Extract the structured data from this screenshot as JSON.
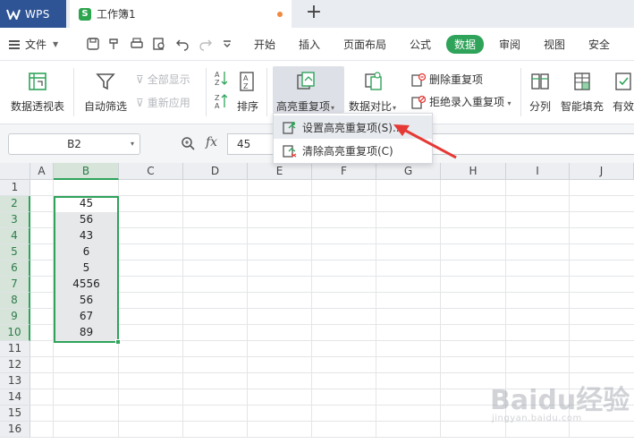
{
  "titlebar": {
    "app_tab": "WPS",
    "doc_tab": "工作簿1",
    "sheet_icon_letter": "S",
    "add_tab": "+"
  },
  "menubar": {
    "file": "文件",
    "tabs": [
      "开始",
      "插入",
      "页面布局",
      "公式",
      "数据",
      "审阅",
      "视图",
      "安全"
    ],
    "active_tab": "数据"
  },
  "ribbon": {
    "pivot": "数据透视表",
    "autofilter": "自动筛选",
    "show_all": "全部显示",
    "reapply": "重新应用",
    "sort": "排序",
    "highlight_dup": "高亮重复项",
    "compare": "数据对比",
    "remove_dup": "删除重复项",
    "reject_dup": "拒绝录入重复项",
    "split": "分列",
    "smart_fill": "智能填充",
    "valid": "有效"
  },
  "dropdown": {
    "set_highlight": "设置高亮重复项(S)...",
    "clear_highlight": "清除高亮重复项(C)"
  },
  "formulabar": {
    "name_box": "B2",
    "fx": "fx",
    "value": "45"
  },
  "grid": {
    "columns": [
      "A",
      "B",
      "C",
      "D",
      "E",
      "F",
      "G",
      "H",
      "I",
      "J"
    ],
    "rows": [
      "1",
      "2",
      "3",
      "4",
      "5",
      "6",
      "7",
      "8",
      "9",
      "10",
      "11",
      "12",
      "13",
      "14",
      "15",
      "16"
    ],
    "b_values": [
      "45",
      "56",
      "43",
      "6",
      "5",
      "4556",
      "56",
      "67",
      "89"
    ]
  },
  "watermark": {
    "text": "Baidu经验",
    "url": "jingyan.baidu.com"
  },
  "colors": {
    "accent_green": "#2fa35a",
    "wps_blue": "#2f5496",
    "arrow_red": "#e53935"
  }
}
